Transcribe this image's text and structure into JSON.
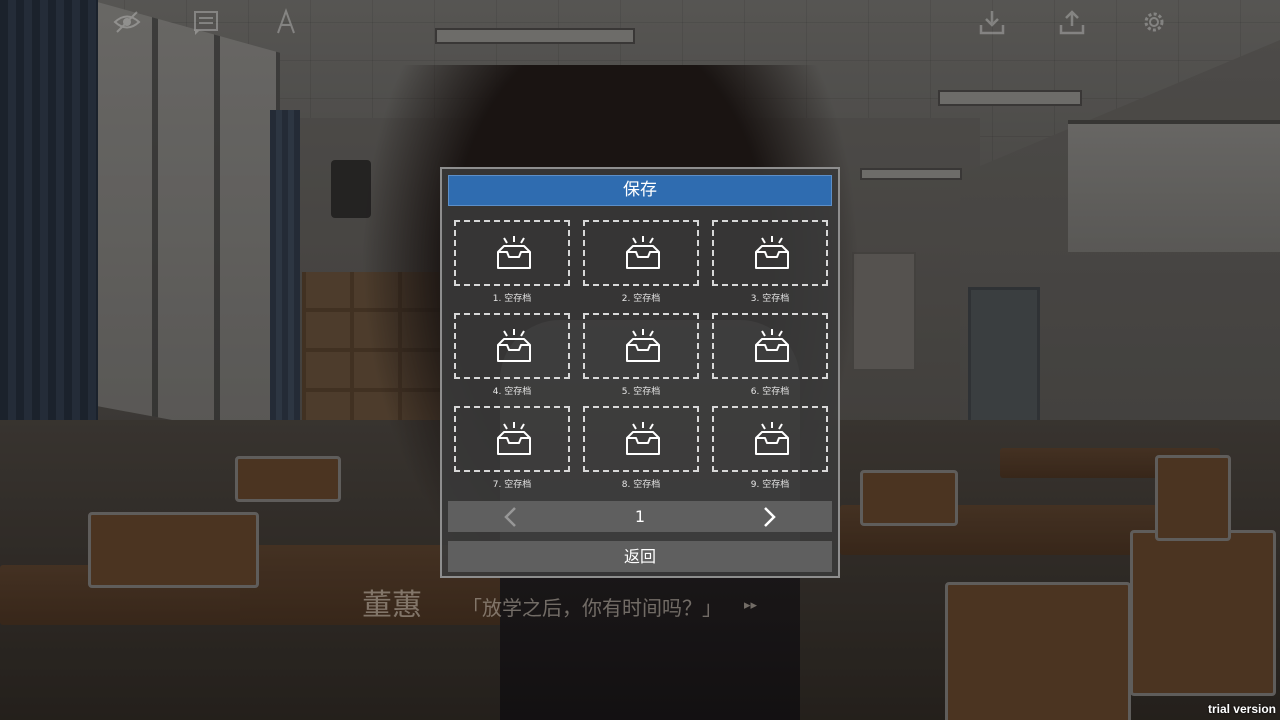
{
  "quick_menu": {
    "icons": [
      "eye-icon",
      "history-icon",
      "font-icon",
      "download-icon",
      "upload-icon",
      "gear-icon"
    ]
  },
  "dialogue": {
    "speaker": "董蕙",
    "line": "「放学之后，你有时间吗？」"
  },
  "save_panel": {
    "title": "保存",
    "slots": [
      {
        "label": "1. 空存档"
      },
      {
        "label": "2. 空存档"
      },
      {
        "label": "3. 空存档"
      },
      {
        "label": "4. 空存档"
      },
      {
        "label": "5. 空存档"
      },
      {
        "label": "6. 空存档"
      },
      {
        "label": "7. 空存档"
      },
      {
        "label": "8. 空存档"
      },
      {
        "label": "9. 空存档"
      }
    ],
    "page": "1",
    "back_label": "返回"
  },
  "watermark": "trial version",
  "colors": {
    "title_bar": "#2f6cb0",
    "panel_bg": "#3a3a3a",
    "button_bg": "#5f5f5f"
  }
}
